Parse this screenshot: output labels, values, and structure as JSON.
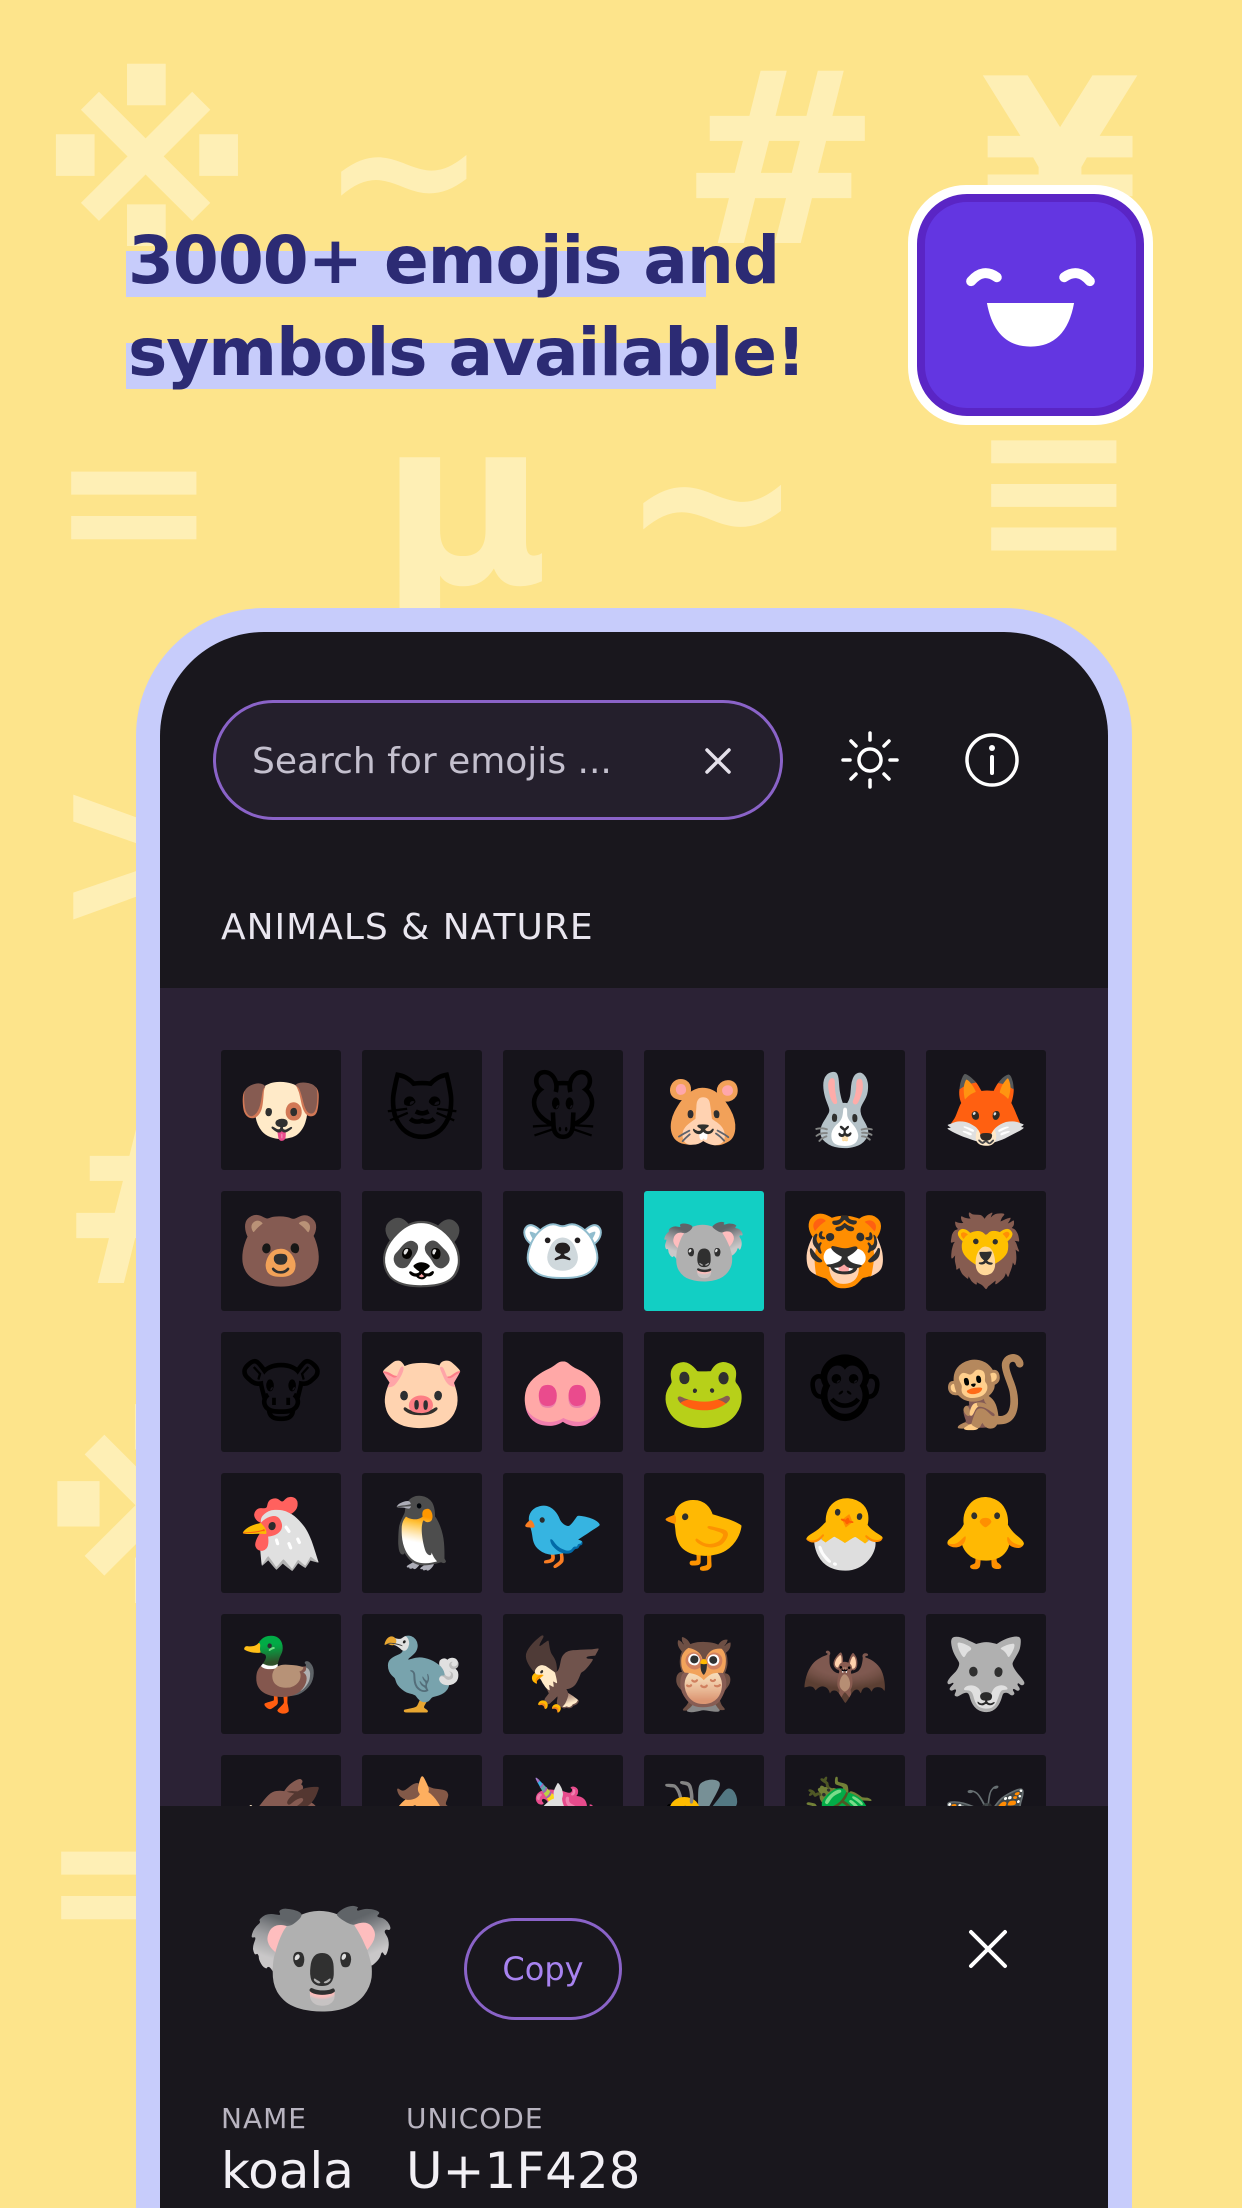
{
  "headline": {
    "line1": "3000+ emojis and",
    "line2": "symbols available!"
  },
  "colors": {
    "background": "#fde48b",
    "headline_text": "#2c2b74",
    "headline_highlight": "#c7ccfb",
    "app_icon": "#6336e1",
    "phone_frame": "#c7ccfb",
    "screen_bg": "#19171d",
    "grid_bg": "#2b2235",
    "accent_purple": "#8a63c8",
    "selected_cell": "#12cfc4"
  },
  "background_glyphs": [
    {
      "glyph": "※",
      "name": "reference-mark-glyph"
    },
    {
      "glyph": "~",
      "name": "tilde-glyph"
    },
    {
      "glyph": "#",
      "name": "hash-glyph"
    },
    {
      "glyph": "¥",
      "name": "yen-glyph"
    },
    {
      "glyph": "=",
      "name": "equals-glyph"
    },
    {
      "glyph": "µ",
      "name": "mu-glyph"
    },
    {
      "glyph": "~",
      "name": "tilde-glyph-2"
    },
    {
      "glyph": "≡",
      "name": "triple-bar-glyph"
    },
    {
      "glyph": ">",
      "name": "greater-than-glyph"
    },
    {
      "glyph": "#",
      "name": "hash-glyph-2"
    },
    {
      "glyph": "※",
      "name": "reference-mark-glyph-2"
    },
    {
      "glyph": "=",
      "name": "equals-glyph-2"
    }
  ],
  "search": {
    "placeholder": "Search for emojis ...",
    "value": "",
    "clear_icon": "close-icon"
  },
  "toolbar": {
    "theme_icon": "sun-icon",
    "info_icon": "info-icon"
  },
  "category": {
    "title": "ANIMALS & NATURE"
  },
  "emojis": [
    {
      "char": "🐶",
      "name": "dog"
    },
    {
      "char": "🐱",
      "name": "cat"
    },
    {
      "char": "🐭",
      "name": "mouse"
    },
    {
      "char": "🐹",
      "name": "hamster"
    },
    {
      "char": "🐰",
      "name": "rabbit"
    },
    {
      "char": "🦊",
      "name": "fox"
    },
    {
      "char": "🐻",
      "name": "bear"
    },
    {
      "char": "🐼",
      "name": "panda"
    },
    {
      "char": "🐻‍❄️",
      "name": "polar-bear"
    },
    {
      "char": "🐨",
      "name": "koala",
      "selected": true
    },
    {
      "char": "🐯",
      "name": "tiger"
    },
    {
      "char": "🦁",
      "name": "lion"
    },
    {
      "char": "🐮",
      "name": "cow"
    },
    {
      "char": "🐷",
      "name": "pig"
    },
    {
      "char": "🐽",
      "name": "pig-nose"
    },
    {
      "char": "🐸",
      "name": "frog"
    },
    {
      "char": "🐵",
      "name": "monkey-face"
    },
    {
      "char": "🐒",
      "name": "monkey"
    },
    {
      "char": "🐔",
      "name": "chicken"
    },
    {
      "char": "🐧",
      "name": "penguin"
    },
    {
      "char": "🐦",
      "name": "bird"
    },
    {
      "char": "🐤",
      "name": "baby-chick"
    },
    {
      "char": "🐣",
      "name": "hatching-chick"
    },
    {
      "char": "🐥",
      "name": "front-facing-chick"
    },
    {
      "char": "🦆",
      "name": "duck"
    },
    {
      "char": "🦤",
      "name": "dodo"
    },
    {
      "char": "🦅",
      "name": "eagle"
    },
    {
      "char": "🦉",
      "name": "owl"
    },
    {
      "char": "🦇",
      "name": "bat"
    },
    {
      "char": "🐺",
      "name": "wolf"
    },
    {
      "char": "🐗",
      "name": "boar"
    },
    {
      "char": "🐴",
      "name": "horse"
    },
    {
      "char": "🦄",
      "name": "unicorn"
    },
    {
      "char": "🐝",
      "name": "bee"
    },
    {
      "char": "🪲",
      "name": "beetle"
    },
    {
      "char": "🦋",
      "name": "butterfly"
    }
  ],
  "detail": {
    "emoji": "🐨",
    "copy_label": "Copy",
    "close_icon": "close-icon",
    "name_label": "NAME",
    "name_value": "koala",
    "unicode_label": "UNICODE",
    "unicode_value": "U+1F428"
  }
}
